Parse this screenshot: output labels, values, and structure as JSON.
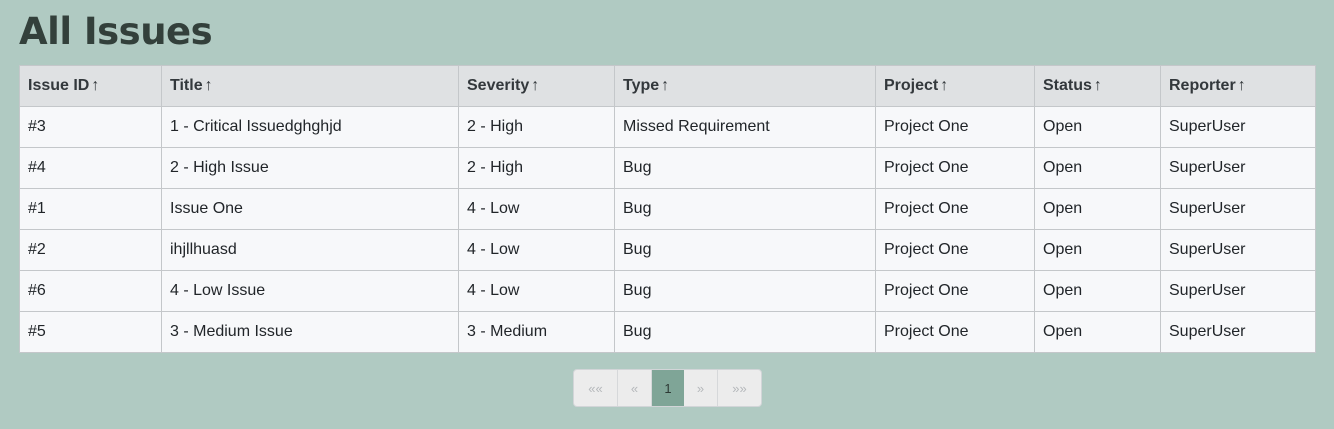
{
  "page": {
    "title": "All Issues"
  },
  "table": {
    "columns": [
      {
        "label": "Issue ID",
        "sort_icon": "↑"
      },
      {
        "label": "Title",
        "sort_icon": "↑"
      },
      {
        "label": "Severity",
        "sort_icon": "↑"
      },
      {
        "label": "Type",
        "sort_icon": "↑"
      },
      {
        "label": "Project",
        "sort_icon": "↑"
      },
      {
        "label": "Status",
        "sort_icon": "↑"
      },
      {
        "label": "Reporter",
        "sort_icon": "↑"
      }
    ],
    "rows": [
      {
        "id": "#3",
        "title": "1 - Critical Issuedghghjd",
        "severity": "2 - High",
        "type": "Missed Requirement",
        "project": "Project One",
        "status": "Open",
        "reporter": "SuperUser"
      },
      {
        "id": "#4",
        "title": "2 - High Issue",
        "severity": "2 - High",
        "type": "Bug",
        "project": "Project One",
        "status": "Open",
        "reporter": "SuperUser"
      },
      {
        "id": "#1",
        "title": "Issue One",
        "severity": "4 - Low",
        "type": "Bug",
        "project": "Project One",
        "status": "Open",
        "reporter": "SuperUser"
      },
      {
        "id": "#2",
        "title": "ihjllhuasd",
        "severity": "4 - Low",
        "type": "Bug",
        "project": "Project One",
        "status": "Open",
        "reporter": "SuperUser"
      },
      {
        "id": "#6",
        "title": "4 - Low Issue",
        "severity": "4 - Low",
        "type": "Bug",
        "project": "Project One",
        "status": "Open",
        "reporter": "SuperUser"
      },
      {
        "id": "#5",
        "title": "3 - Medium Issue",
        "severity": "3 - Medium",
        "type": "Bug",
        "project": "Project One",
        "status": "Open",
        "reporter": "SuperUser"
      }
    ]
  },
  "pagination": {
    "first_label": "««",
    "prev_label": "«",
    "current_page": "1",
    "next_label": "»",
    "last_label": "»»"
  },
  "colors": {
    "background": "#b0cac2",
    "active_page": "#7fa597",
    "header_bg": "#dfe1e3"
  }
}
